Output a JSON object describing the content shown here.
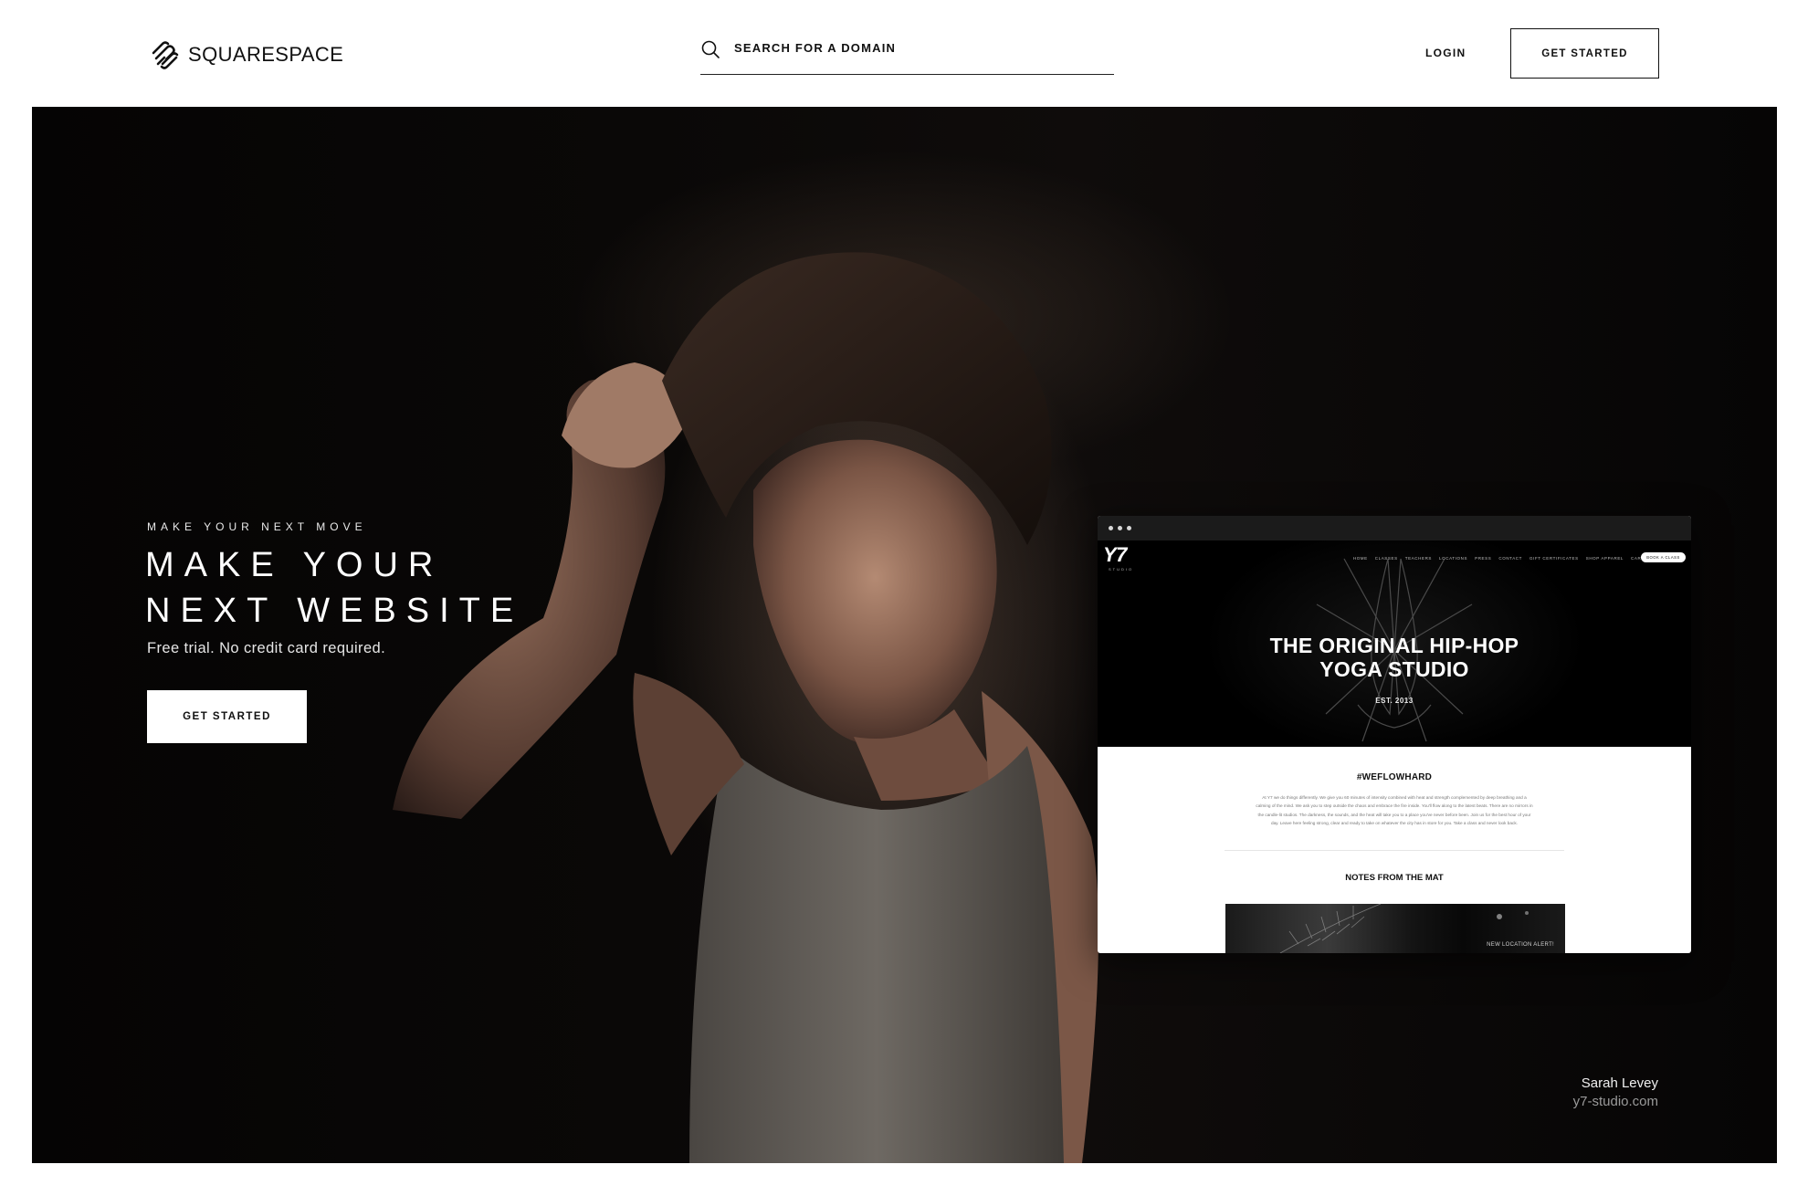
{
  "header": {
    "logo_text": "SQUARESPACE",
    "search_placeholder": "SEARCH FOR A DOMAIN",
    "login_label": "LOGIN",
    "cta_label": "GET STARTED"
  },
  "hero": {
    "eyebrow": "MAKE YOUR NEXT MOVE",
    "headline_line1": "MAKE YOUR",
    "headline_line2": "NEXT WEBSITE",
    "subline": "Free trial. No credit card required.",
    "cta_label": "GET STARTED",
    "credit_name": "Sarah Levey",
    "credit_site": "y7-studio.com"
  },
  "mockup": {
    "logo": "Y7",
    "logo_sub": "STUDIO",
    "nav": [
      "HOME",
      "CLASSES",
      "TEACHERS",
      "LOCATIONS",
      "PRESS",
      "CONTACT",
      "GIFT CERTIFICATES",
      "SHOP APPAREL",
      "CAREERS"
    ],
    "book_label": "BOOK A CLASS",
    "title_line1": "THE ORIGINAL HIP-HOP",
    "title_line2": "YOGA STUDIO",
    "est": "EST. 2013",
    "section1_heading": "#WEFLOWHARD",
    "section1_body": "At Y7 we do things differently. We give you 60 minutes of intensity combined with heat and strength complemented by deep breathing and a calming of the mind. We ask you to step outside the chaos and embrace the fire inside. You'll flow along to the latest beats. There are no mirrors in the candle-lit studios. The darkness, the sounds, and the heat will take you to a place you've never before been. Join us for the best hour of your day. Leave here feeling strong, clear and ready to take on whatever the city has in store for you. Take a class and never look back.",
    "section2_heading": "NOTES FROM THE MAT",
    "strip_label": "NEW LOCATION ALERT!"
  },
  "colors": {
    "hero_bg": "#070505",
    "text_dark": "#111111",
    "text_light": "#ffffff",
    "credit_muted": "#9a9a9a"
  },
  "icons": {
    "logo": "squarespace-logo-icon",
    "search": "search-icon"
  }
}
